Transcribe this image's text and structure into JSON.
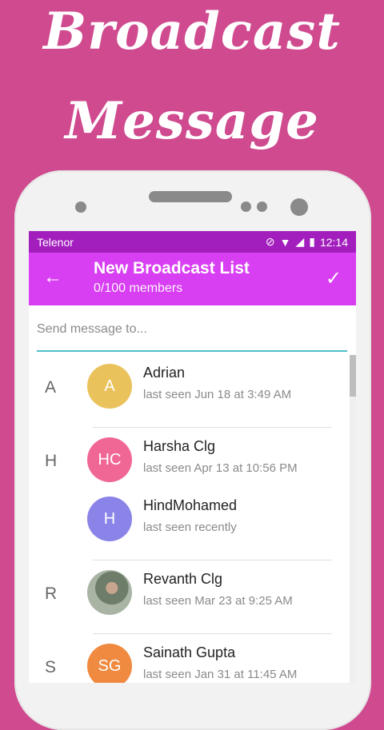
{
  "banner": {
    "line1": "Broadcast",
    "line2": "Message"
  },
  "status": {
    "carrier": "Telenor",
    "time": "12:14"
  },
  "appbar": {
    "title": "New Broadcast List",
    "subtitle": "0/100 members",
    "back_icon": "arrow-left-icon",
    "confirm_icon": "check-icon"
  },
  "search": {
    "placeholder": "Send message to..."
  },
  "contacts": [
    {
      "letter": "A",
      "initials": "A",
      "name": "Adrian",
      "seen": "last seen Jun 18 at 3:49 AM",
      "color": "#e9c25b"
    },
    {
      "letter": "H",
      "initials": "HC",
      "name": "Harsha Clg",
      "seen": "last seen Apr 13 at 10:56 PM",
      "color": "#f06796"
    },
    {
      "letter": "",
      "initials": "H",
      "name": "HindMohamed",
      "seen": "last seen recently",
      "color": "#8a83e8"
    },
    {
      "letter": "R",
      "initials": "",
      "name": "Revanth Clg",
      "seen": "last seen Mar 23 at 9:25 AM",
      "color": "#7f8f7a"
    },
    {
      "letter": "S",
      "initials": "SG",
      "name": "Sainath Gupta",
      "seen": "last seen Jan 31 at 11:45 AM",
      "color": "#ef8a40"
    }
  ]
}
